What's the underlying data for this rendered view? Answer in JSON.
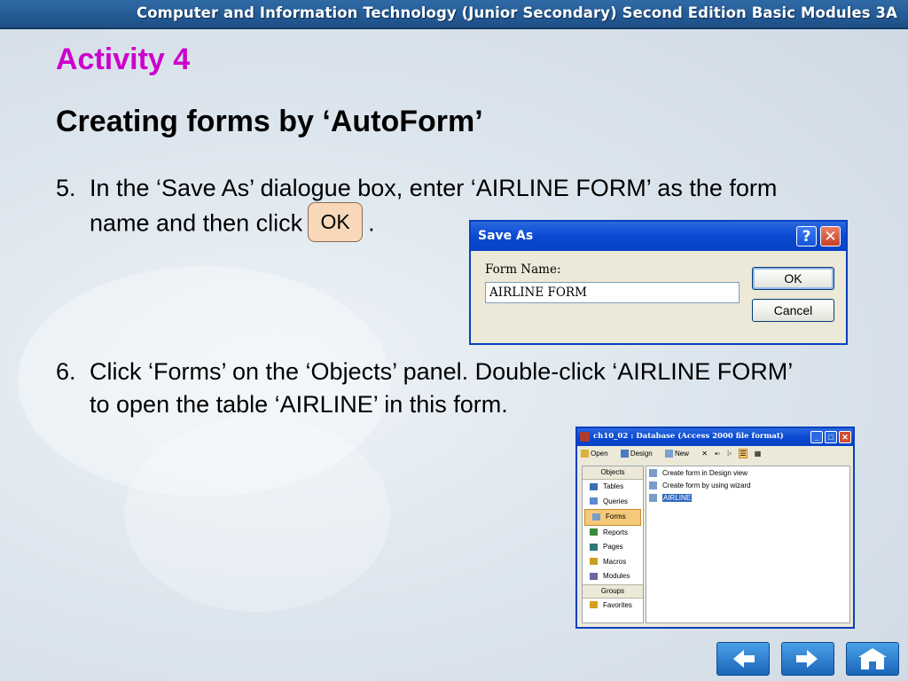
{
  "header": {
    "title": "Computer and Information Technology (Junior Secondary) Second Edition Basic Modules 3A"
  },
  "slide": {
    "activity": "Activity 4",
    "subtitle": "Creating forms by ‘AutoForm’",
    "step5": {
      "number": "5.",
      "line1": "In the ‘Save As’ dialogue box, enter ‘AIRLINE FORM’ as the form",
      "line2_before": "name and then click",
      "ok_label": "OK",
      "line2_after": "."
    },
    "step6": {
      "number": "6.",
      "line1": "Click ‘Forms’ on the ‘Objects’ panel. Double-click ‘AIRLINE FORM’",
      "line2": "to open the table ‘AIRLINE’ in this form."
    }
  },
  "save_as_dialog": {
    "title": "Save As",
    "help_symbol": "?",
    "close_symbol": "✕",
    "field_label": "Form Name:",
    "field_value": "AIRLINE FORM",
    "ok_label": "OK",
    "cancel_label": "Cancel"
  },
  "db_window": {
    "title": "ch10_02 : Database (Access 2000 file format)",
    "toolbar": {
      "open": "Open",
      "design": "Design",
      "new": "New"
    },
    "objects_header": "Objects",
    "objects": [
      {
        "label": "Tables",
        "icon": "table-icon",
        "color": "#3a6fb5"
      },
      {
        "label": "Queries",
        "icon": "query-icon",
        "color": "#5a8ad0"
      },
      {
        "label": "Forms",
        "icon": "form-icon",
        "color": "#7a9cc8",
        "selected": true
      },
      {
        "label": "Reports",
        "icon": "report-icon",
        "color": "#3a8a3a"
      },
      {
        "label": "Pages",
        "icon": "page-icon",
        "color": "#2f7a7a"
      },
      {
        "label": "Macros",
        "icon": "macro-icon",
        "color": "#c8a020"
      },
      {
        "label": "Modules",
        "icon": "module-icon",
        "color": "#6a6aa0"
      }
    ],
    "groups_header": "Groups",
    "groups": [
      {
        "label": "Favorites",
        "icon": "favorites-icon",
        "color": "#d4a020"
      }
    ],
    "entries": [
      {
        "label": "Create form in Design view",
        "icon": "design-view-icon"
      },
      {
        "label": "Create form by using wizard",
        "icon": "wizard-icon"
      },
      {
        "label": "AIRLINE",
        "icon": "form-icon",
        "selected": true
      }
    ]
  },
  "navigation": {
    "back": "arrow-left-icon",
    "forward": "arrow-right-icon",
    "home": "home-icon"
  }
}
